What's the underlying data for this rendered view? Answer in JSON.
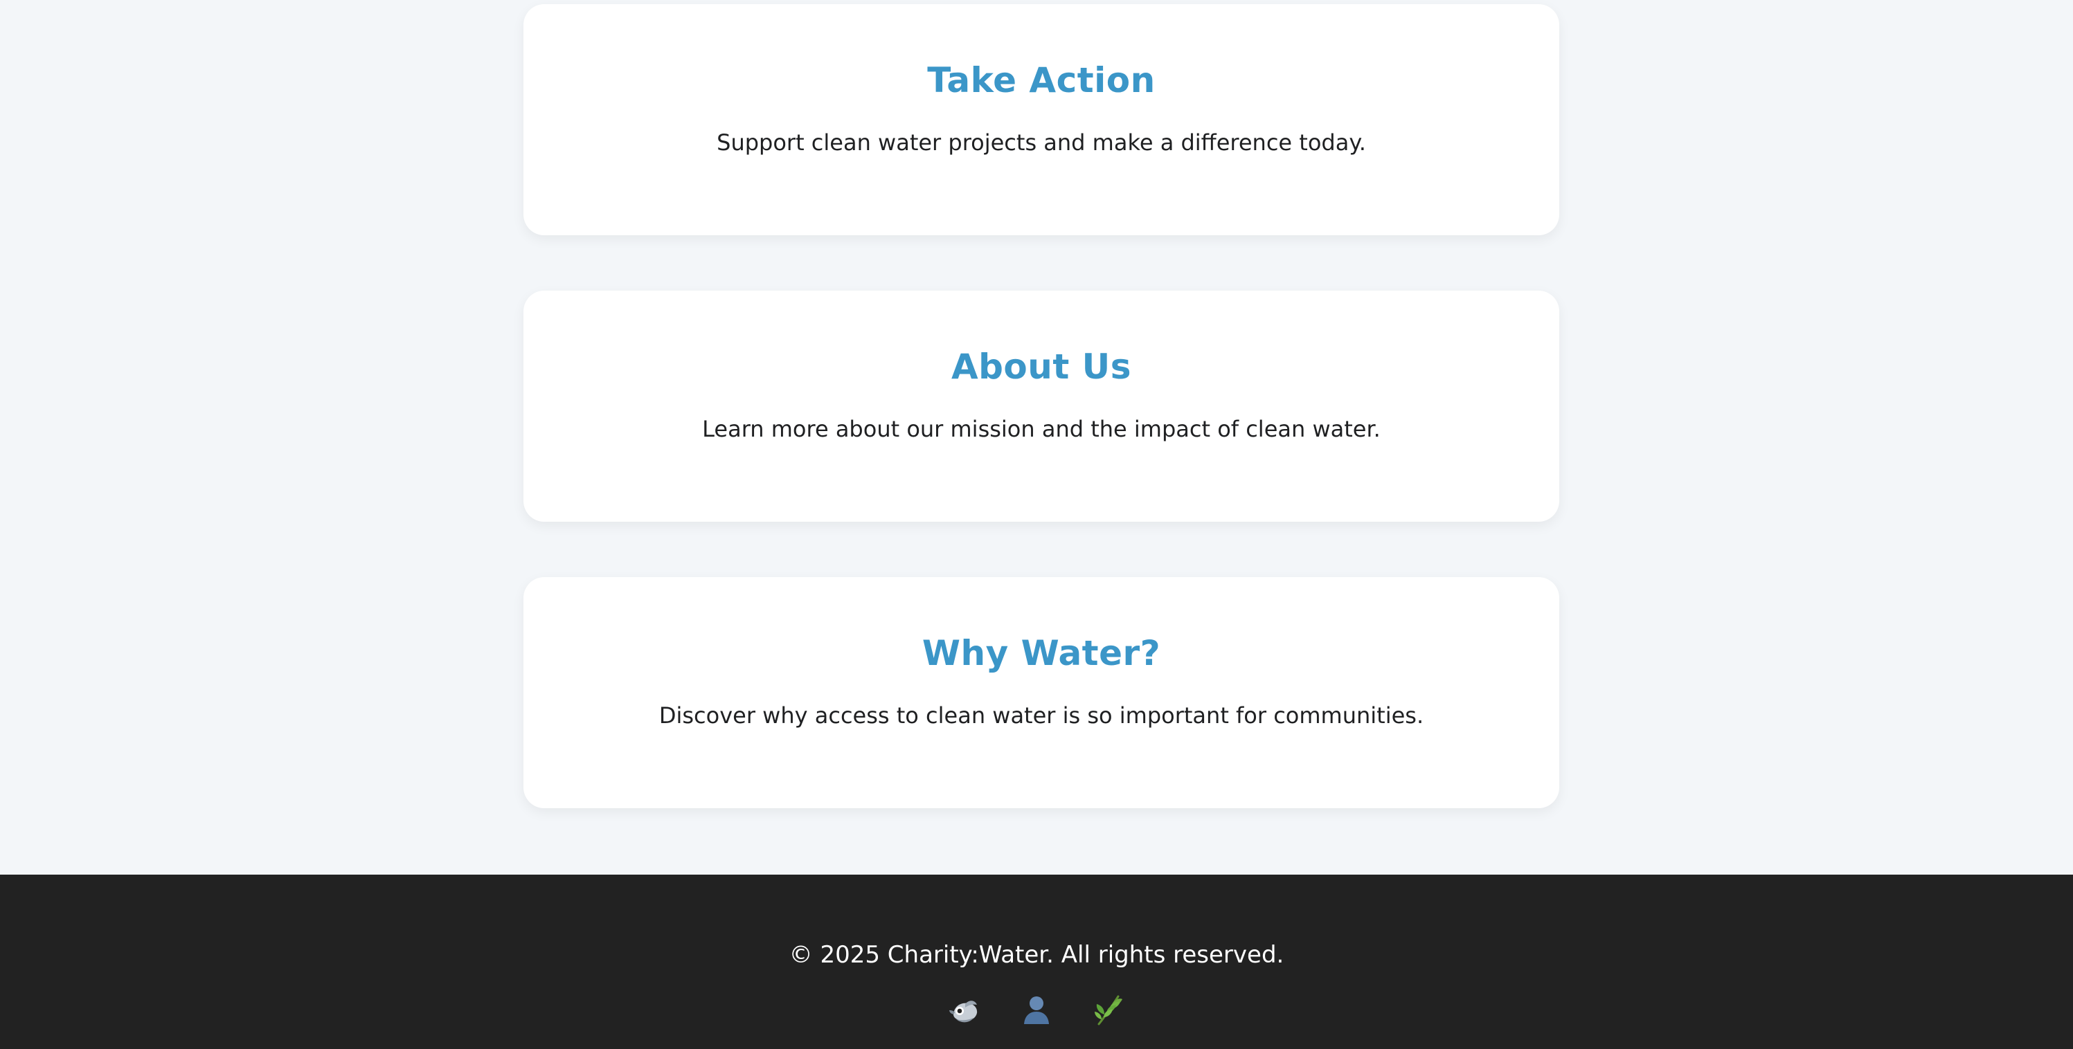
{
  "cards": [
    {
      "title": "Take Action",
      "text": "Support clean water projects and make a difference today."
    },
    {
      "title": "About Us",
      "text": "Learn more about our mission and the impact of clean water."
    },
    {
      "title": "Why Water?",
      "text": "Discover why access to clean water is so important for communities."
    }
  ],
  "footer": {
    "copyright": "© 2025 Charity:Water. All rights reserved.",
    "social_icons": [
      "bird-icon",
      "person-icon",
      "leaf-icon"
    ]
  },
  "colors": {
    "page_background": "#f3f6f9",
    "card_background": "#ffffff",
    "card_title": "#3b96c8",
    "body_text": "#1f2022",
    "footer_background": "#222222",
    "footer_text": "#ffffff"
  }
}
